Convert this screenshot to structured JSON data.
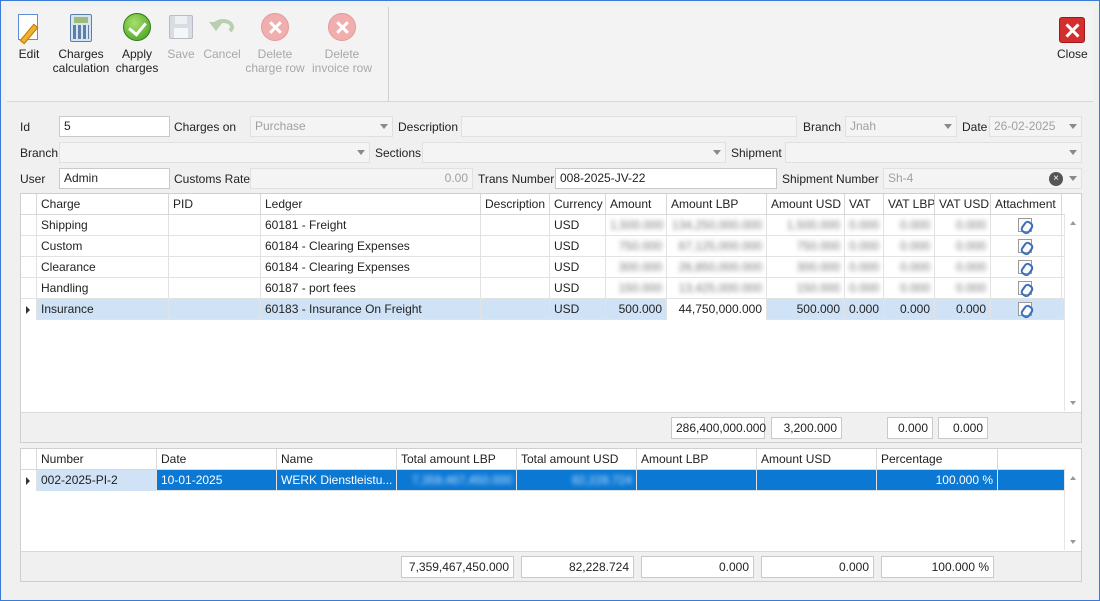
{
  "toolbar": {
    "edit": "Edit",
    "charges_calc_1": "Charges",
    "charges_calc_2": "calculation",
    "apply_1": "Apply",
    "apply_2": "charges",
    "save": "Save",
    "cancel": "Cancel",
    "delete_charge_1": "Delete",
    "delete_charge_2": "charge row",
    "delete_invoice_1": "Delete",
    "delete_invoice_2": "invoice row",
    "close": "Close"
  },
  "form": {
    "id_label": "Id",
    "id_value": "5",
    "charges_on_label": "Charges on",
    "charges_on_value": "Purchase",
    "description_label": "Description",
    "description_value": "",
    "branch_label": "Branch",
    "branch_value": "Jnah",
    "date_label": "Date",
    "date_value": "26-02-2025",
    "branch2_label": "Branch",
    "branch2_value": "",
    "sections_label": "Sections",
    "sections_value": "",
    "shipment_label": "Shipment",
    "shipment_value": "",
    "user_label": "User",
    "user_value": "Admin",
    "customs_rate_label": "Customs Rate",
    "customs_rate_value": "0.00",
    "trans_number_label": "Trans Number",
    "trans_number_value": "008-2025-JV-22",
    "shipment_number_label": "Shipment Number",
    "shipment_number_value": "Sh-4"
  },
  "charges_grid": {
    "columns": [
      "Charge",
      "PID",
      "Ledger",
      "Description",
      "Currency",
      "Amount",
      "Amount LBP",
      "Amount USD",
      "VAT",
      "VAT LBP",
      "VAT USD",
      "Attachment"
    ],
    "rows": [
      {
        "charge": "Shipping",
        "pid": "",
        "ledger": "60181 - Freight",
        "description": "",
        "currency": "USD",
        "amount": "1,500.000",
        "amount_lbp": "134,250,000.000",
        "amount_usd": "1,500.000",
        "vat": "0.000",
        "vat_lbp": "0.000",
        "vat_usd": "0.000"
      },
      {
        "charge": "Custom",
        "pid": "",
        "ledger": "60184 - Clearing Expenses",
        "description": "",
        "currency": "USD",
        "amount": "750.000",
        "amount_lbp": "67,125,000.000",
        "amount_usd": "750.000",
        "vat": "0.000",
        "vat_lbp": "0.000",
        "vat_usd": "0.000"
      },
      {
        "charge": "Clearance",
        "pid": "",
        "ledger": "60184 - Clearing Expenses",
        "description": "",
        "currency": "USD",
        "amount": "300.000",
        "amount_lbp": "26,850,000.000",
        "amount_usd": "300.000",
        "vat": "0.000",
        "vat_lbp": "0.000",
        "vat_usd": "0.000"
      },
      {
        "charge": "Handling",
        "pid": "",
        "ledger": "60187 - port  fees",
        "description": "",
        "currency": "USD",
        "amount": "150.000",
        "amount_lbp": "13,425,000.000",
        "amount_usd": "150.000",
        "vat": "0.000",
        "vat_lbp": "0.000",
        "vat_usd": "0.000"
      },
      {
        "charge": "Insurance",
        "pid": "",
        "ledger": "60183 - Insurance On Freight",
        "description": "",
        "currency": "USD",
        "amount": "500.000",
        "amount_lbp": "44,750,000.000",
        "amount_usd": "500.000",
        "vat": "0.000",
        "vat_lbp": "0.000",
        "vat_usd": "0.000"
      }
    ],
    "totals": {
      "amount_lbp": "286,400,000.000",
      "amount_usd": "3,200.000",
      "vat_lbp": "0.000",
      "vat_usd": "0.000"
    }
  },
  "invoice_grid": {
    "columns": [
      "Number",
      "Date",
      "Name",
      "Total amount LBP",
      "Total amount USD",
      "Amount LBP",
      "Amount USD",
      "Percentage"
    ],
    "rows": [
      {
        "number": "002-2025-PI-2",
        "date": "10-01-2025",
        "name": "WERK  Dienstleistu...",
        "total_lbp": "7,359,467,450.000",
        "total_usd": "82,228.724",
        "amount_lbp": "",
        "amount_usd": "",
        "percentage": "100.000 %"
      }
    ],
    "totals": {
      "total_lbp": "7,359,467,450.000",
      "total_usd": "82,228.724",
      "amount_lbp": "0.000",
      "amount_usd": "0.000",
      "percentage": "100.000 %"
    }
  }
}
